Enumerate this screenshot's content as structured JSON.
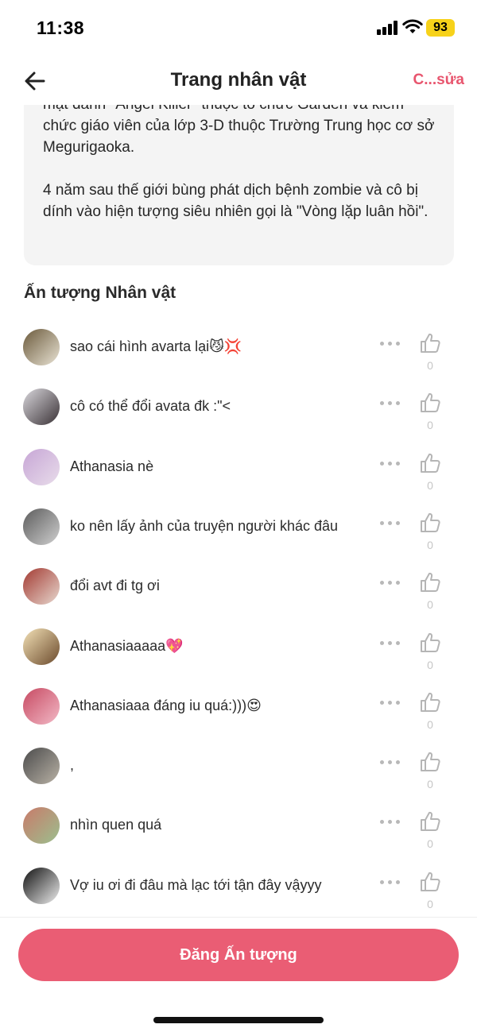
{
  "status_bar": {
    "time": "11:38",
    "battery": "93"
  },
  "nav": {
    "title": "Trang nhân vật",
    "edit_label": "C...sửa"
  },
  "bio": {
    "partial_line": "mật danh \"Angel Killer\" thuộc tổ chức Garden và kiêm",
    "paragraph1": "chức giáo viên của lớp 3-D thuộc Trường Trung học cơ sở Megurigaoka.",
    "paragraph2": "4 năm sau thế giới bùng phát dịch bệnh zombie và cô bị dính vào hiện tượng siêu nhiên gọi là \"Vòng lặp luân hồi\"."
  },
  "impressions": {
    "title": "Ấn tượng Nhân vật",
    "comments": [
      {
        "text": "sao cái hình avarta lại😼💢",
        "likes": "0",
        "avatar_colors": [
          "#6b5a3c",
          "#e9e3d4"
        ]
      },
      {
        "text": "cô có thể đổi avata đk :\"<",
        "likes": "0",
        "avatar_colors": [
          "#d9d7dc",
          "#3a3236"
        ]
      },
      {
        "text": "Athanasia nè",
        "likes": "0",
        "avatar_colors": [
          "#c7a6d6",
          "#e8dcea"
        ]
      },
      {
        "text": "ko nên lấy ảnh của truyện người khác đâu",
        "likes": "0",
        "avatar_colors": [
          "#5c5c5c",
          "#cfcfcf"
        ]
      },
      {
        "text": "đổi avt đi tg ơi",
        "likes": "0",
        "avatar_colors": [
          "#a33a32",
          "#e7d8cf"
        ]
      },
      {
        "text": "Athanasiaaaaa💖",
        "likes": "0",
        "avatar_colors": [
          "#f3e1b6",
          "#6b4a2c"
        ]
      },
      {
        "text": "Athanasiaaa đáng iu quá:)))😍",
        "likes": "0",
        "avatar_colors": [
          "#c74a62",
          "#f2b9c6"
        ]
      },
      {
        "text": ",",
        "likes": "0",
        "avatar_colors": [
          "#4b4b4b",
          "#b9b2a6"
        ]
      },
      {
        "text": "nhìn quen quá",
        "likes": "0",
        "avatar_colors": [
          "#c97a6a",
          "#9bbf8e"
        ]
      },
      {
        "text": "Vợ iu ơi đi đâu mà lạc tới tận đây vậyyy",
        "likes": "0",
        "avatar_colors": [
          "#111111",
          "#eeeeee"
        ]
      }
    ]
  },
  "post_button_label": "Đăng Ấn tượng",
  "colors": {
    "accent": "#ea5d74",
    "edit": "#e8556e",
    "card_bg": "#f4f4f4"
  }
}
